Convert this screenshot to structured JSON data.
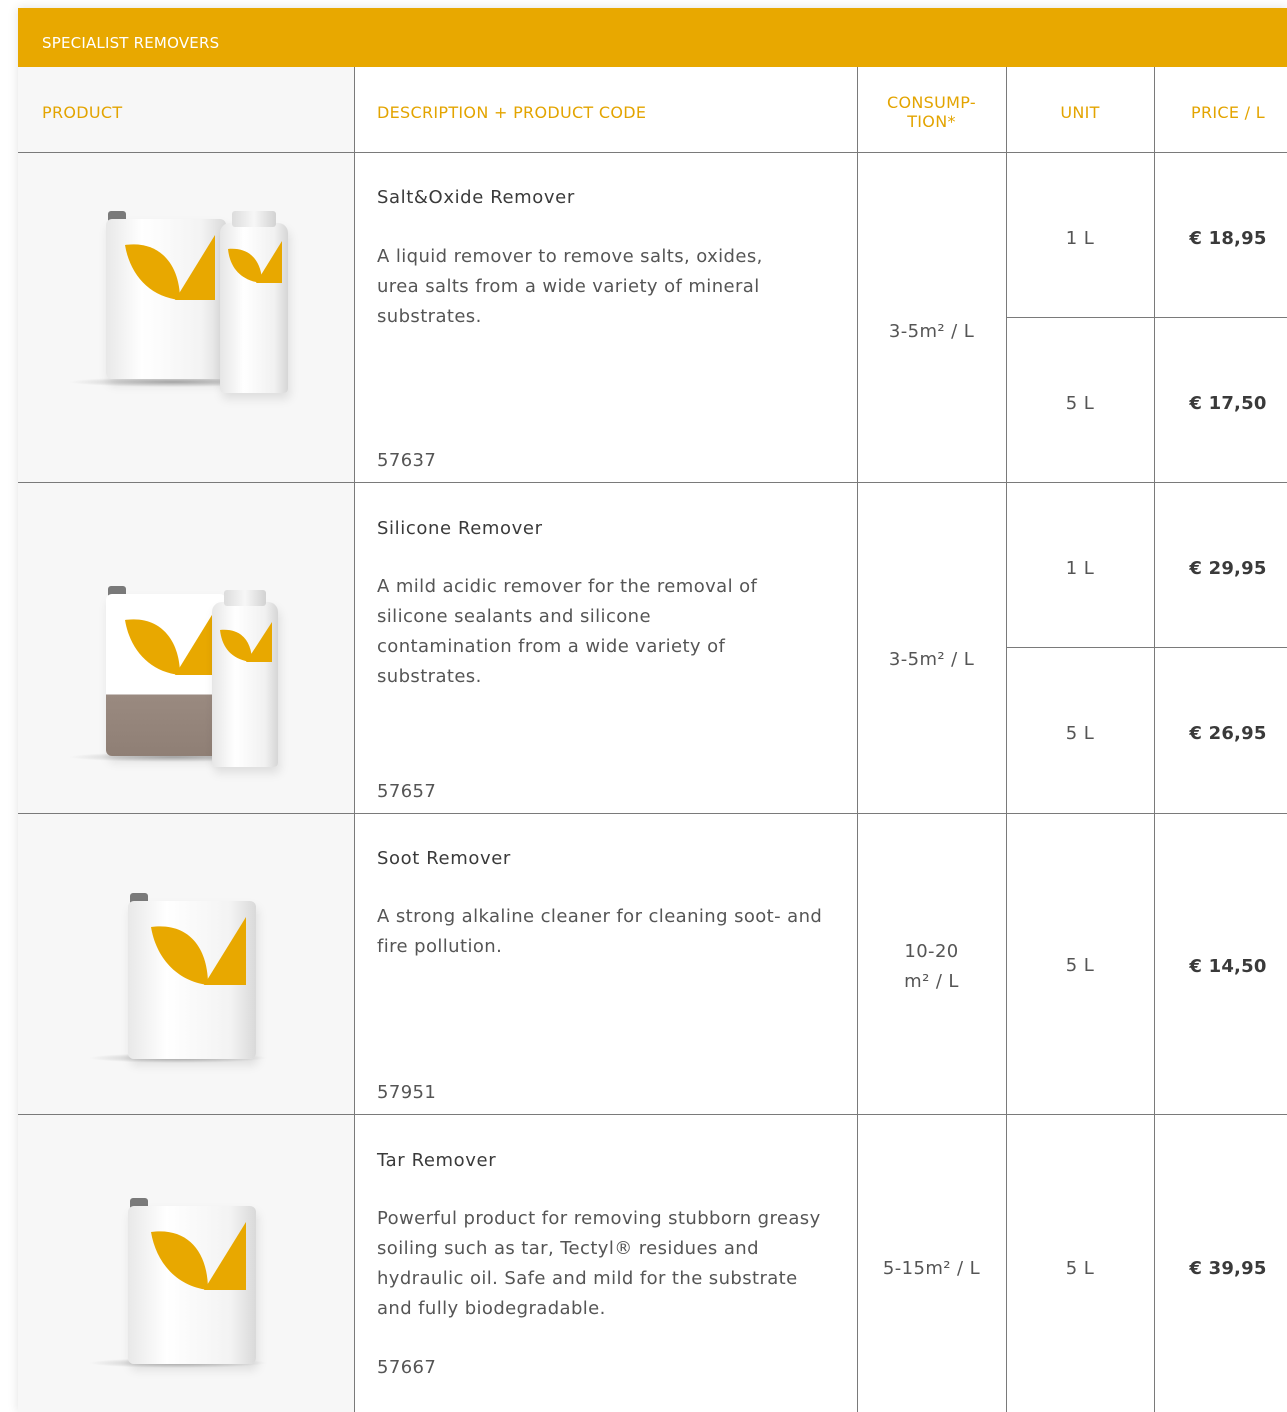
{
  "section_title": "SPECIALIST REMOVERS",
  "columns": {
    "product": "PRODUCT",
    "description": "DESCRIPTION + PRODUCT CODE",
    "consumption_line1": "CONSUMP-",
    "consumption_line2": "TION*",
    "unit": "UNIT",
    "price": "PRICE / L"
  },
  "colors": {
    "accent": "#E8A800",
    "header_text": "#E3A400"
  },
  "products": [
    {
      "name": "Salt&Oxide Remover",
      "description": "A liquid remover to remove salts, oxides, urea salts from a wide variety of mineral substrates.",
      "code": "57637",
      "consumption": "3-5m² / L",
      "variants": [
        {
          "unit": "1 L",
          "price": "€ 18,95"
        },
        {
          "unit": "5 L",
          "price": "€ 17,50"
        }
      ]
    },
    {
      "name": "Silicone Remover",
      "description": "A mild acidic remover for the removal of silicone sealants and silicone contamination from a wide variety of substrates.",
      "code": "57657",
      "consumption": "3-5m² / L",
      "variants": [
        {
          "unit": "1 L",
          "price": "€ 29,95"
        },
        {
          "unit": "5 L",
          "price": "€ 26,95"
        }
      ]
    },
    {
      "name": "Soot Remover",
      "description": "A strong alkaline cleaner for cleaning soot- and fire pollution.",
      "code": "57951",
      "consumption_line1": "10-20",
      "consumption_line2": "m² / L",
      "variants": [
        {
          "unit": "5 L",
          "price": "€ 14,50"
        }
      ]
    },
    {
      "name": "Tar Remover",
      "description": "Powerful product for removing stubborn greasy soiling such as tar, Tectyl® residues and hydraulic oil. Safe and mild for the substrate and fully biodegradable.",
      "code": "57667",
      "consumption": "5-15m² / L",
      "variants": [
        {
          "unit": "5 L",
          "price": "€ 39,95"
        }
      ]
    }
  ]
}
